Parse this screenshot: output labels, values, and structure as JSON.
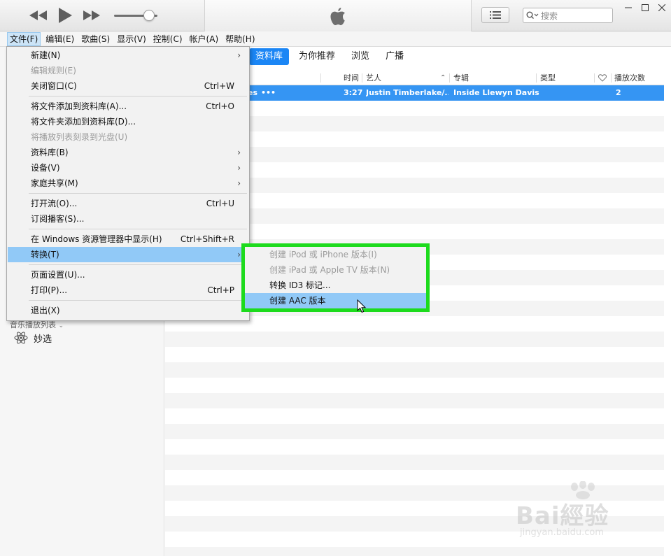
{
  "toolbar": {
    "rewind_icon": "rewind-icon",
    "play_icon": "play-icon",
    "fast_forward_icon": "fast-forward-icon",
    "volume_level": 0.8,
    "lcd_icon": "apple-logo-icon",
    "search_placeholder": "搜索"
  },
  "menubar": {
    "items": [
      {
        "label": "文件(F)",
        "active": true
      },
      {
        "label": "编辑(E)"
      },
      {
        "label": "歌曲(S)"
      },
      {
        "label": "显示(V)"
      },
      {
        "label": "控制(C)"
      },
      {
        "label": "帐户(A)"
      },
      {
        "label": "帮助(H)"
      }
    ]
  },
  "tabs": [
    {
      "label": "资料库",
      "active": true
    },
    {
      "label": "为你推荐"
    },
    {
      "label": "浏览"
    },
    {
      "label": "广播"
    }
  ],
  "columns": {
    "time": "时间",
    "artist": "艺人",
    "album": "专辑",
    "genre": "类型",
    "plays": "播放次数"
  },
  "rows": [
    {
      "title_tail": "es",
      "more": "•••",
      "time": "3:27",
      "artist": "Justin Timberlake/...",
      "album": "Inside Llewyn Davis",
      "plays": "2"
    }
  ],
  "sidebar": {
    "header": "音乐播放列表",
    "item": "妙选"
  },
  "file_menu": {
    "items": [
      {
        "label": "新建(N)",
        "arrow": "›"
      },
      {
        "label": "编辑规则(E)",
        "disabled": true
      },
      {
        "label": "关闭窗口(C)",
        "shortcut": "Ctrl+W"
      },
      {
        "label": "将文件添加到资料库(A)...",
        "shortcut": "Ctrl+O"
      },
      {
        "label": "将文件夹添加到资料库(D)..."
      },
      {
        "label": "将播放列表刻录到光盘(U)",
        "disabled": true
      },
      {
        "label": "资料库(B)",
        "arrow": "›"
      },
      {
        "label": "设备(V)",
        "arrow": "›"
      },
      {
        "label": "家庭共享(M)",
        "arrow": "›"
      },
      {
        "label": "打开流(O)...",
        "shortcut": "Ctrl+U"
      },
      {
        "label": "订阅播客(S)..."
      },
      {
        "label": "在 Windows 资源管理器中显示(H)",
        "shortcut": "Ctrl+Shift+R"
      },
      {
        "label": "转换(T)",
        "arrow": "›",
        "highlighted": true
      },
      {
        "label": "页面设置(U)..."
      },
      {
        "label": "打印(P)...",
        "shortcut": "Ctrl+P"
      },
      {
        "label": "退出(X)"
      }
    ]
  },
  "convert_submenu": {
    "items": [
      {
        "label": "创建 iPod 或 iPhone 版本(I)",
        "disabled": true
      },
      {
        "label": "创建 iPad 或 Apple TV 版本(N)",
        "disabled": true
      },
      {
        "label": "转换 ID3 标记..."
      },
      {
        "label": "创建 AAC 版本",
        "highlighted": true
      }
    ]
  },
  "watermark": {
    "brand": "Bai經验",
    "sub": "jingyan.baidu.com"
  }
}
